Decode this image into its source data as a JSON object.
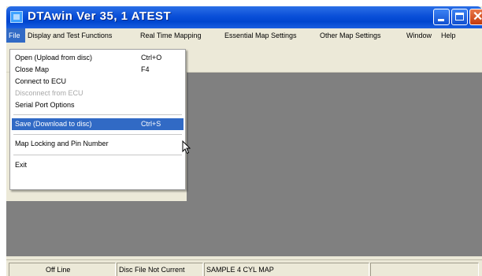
{
  "window": {
    "title": "DTAwin Ver  35, 1  ATEST",
    "icon": "app-icon"
  },
  "menubar": {
    "items": [
      {
        "label": "File",
        "active": true
      },
      {
        "label": "Display and Test Functions"
      },
      {
        "label": "Real Time Mapping"
      },
      {
        "label": "Essential Map Settings"
      },
      {
        "label": "Other Map Settings"
      },
      {
        "label": "Window"
      },
      {
        "label": "Help"
      }
    ]
  },
  "file_menu": {
    "items": [
      {
        "label": "Open (Upload from disc)",
        "shortcut": "Ctrl+O"
      },
      {
        "label": "Close Map",
        "shortcut": "F4"
      },
      {
        "label": "Connect to ECU",
        "shortcut": ""
      },
      {
        "label": "Disconnect from ECU",
        "shortcut": "",
        "disabled": true
      },
      {
        "label": "Serial Port Options",
        "shortcut": ""
      },
      {
        "label": "Save  (Download to disc)",
        "shortcut": "Ctrl+S",
        "highlighted": true
      },
      {
        "label": "Map Locking and Pin Number",
        "shortcut": ""
      },
      {
        "label": "Exit",
        "shortcut": ""
      }
    ]
  },
  "statusbar": {
    "connection": "Off Line",
    "disc_status": "Disc File Not Current",
    "map_name": "SAMPLE 4 CYL MAP"
  },
  "colors": {
    "title_bar": "#0a4fd8",
    "highlight": "#316ac5",
    "mdi_background": "#808080",
    "chrome": "#ece9d8"
  }
}
